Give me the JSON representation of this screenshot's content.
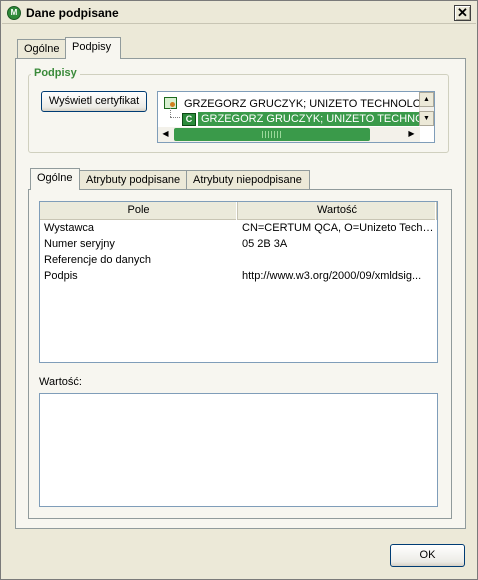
{
  "window": {
    "title": "Dane podpisane",
    "close_glyph": "✕"
  },
  "outer_tabs": [
    {
      "label": "Ogólne"
    },
    {
      "label": "Podpisy"
    }
  ],
  "signatures": {
    "group_label": "Podpisy",
    "show_cert_button": "Wyświetl certyfikat",
    "tree": [
      {
        "label": "GRZEGORZ GRUCZYK; UNIZETO TECHNOLOGIES",
        "icon": "certificate-icon"
      },
      {
        "label": "GRZEGORZ GRUCZYK; UNIZETO TECHNOLOG",
        "icon": "c-icon",
        "icon_letter": "C"
      }
    ]
  },
  "inner_tabs": [
    {
      "label": "Ogólne"
    },
    {
      "label": "Atrybuty podpisane"
    },
    {
      "label": "Atrybuty niepodpisane"
    }
  ],
  "table": {
    "columns": [
      "Pole",
      "Wartość"
    ],
    "rows": [
      {
        "field": "Wystawca",
        "value": "CN=CERTUM QCA, O=Unizeto Techn..."
      },
      {
        "field": "Numer seryjny",
        "value": "05 2B 3A"
      },
      {
        "field": "Referencje do danych",
        "value": ""
      },
      {
        "field": "Podpis",
        "value": "http://www.w3.org/2000/09/xmldsig..."
      }
    ]
  },
  "value_label": "Wartość:",
  "ok_button": "OK"
}
